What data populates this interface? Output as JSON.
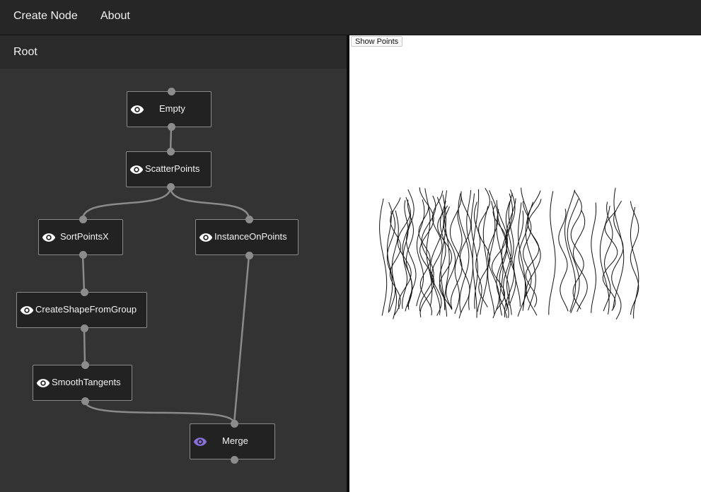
{
  "menu": {
    "create_node": "Create Node",
    "about": "About"
  },
  "breadcrumb": {
    "root": "Root"
  },
  "viewer": {
    "show_points_label": "Show Points"
  },
  "colors": {
    "eye_default": "#ffffff",
    "eye_active": "#8a6fd8"
  },
  "graph": {
    "nodes": [
      {
        "id": "empty",
        "label": "Empty",
        "visible": true,
        "active": false
      },
      {
        "id": "scatter",
        "label": "ScatterPoints",
        "visible": true,
        "active": false
      },
      {
        "id": "sortx",
        "label": "SortPointsX",
        "visible": true,
        "active": false
      },
      {
        "id": "instance",
        "label": "InstanceOnPoints",
        "visible": true,
        "active": false
      },
      {
        "id": "createshape",
        "label": "CreateShapeFromGroup",
        "visible": true,
        "active": false
      },
      {
        "id": "smooth",
        "label": "SmoothTangents",
        "visible": true,
        "active": false
      },
      {
        "id": "merge",
        "label": "Merge",
        "visible": true,
        "active": true
      }
    ]
  }
}
